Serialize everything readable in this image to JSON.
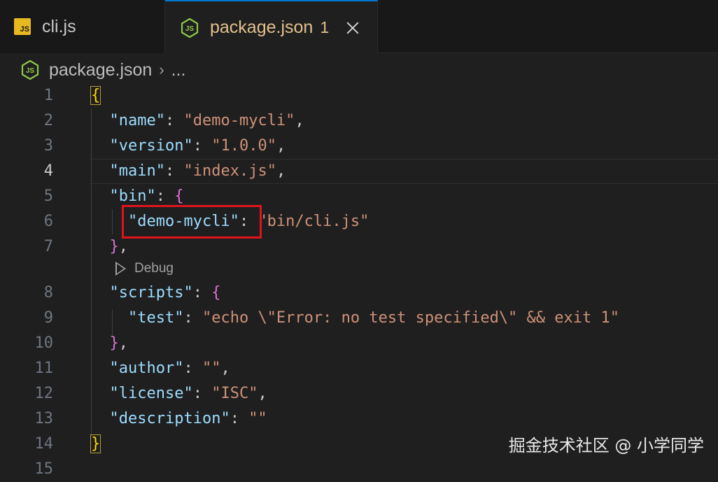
{
  "tabs": [
    {
      "label": "cli.js",
      "icon": "js-file-icon",
      "icon_text": "JS"
    },
    {
      "label": "package.json",
      "badge": "1",
      "icon": "node-json-icon"
    }
  ],
  "breadcrumb": {
    "file": "package.json",
    "separator": "›",
    "more": "..."
  },
  "codelens": {
    "label": "Debug"
  },
  "lines": [
    {
      "n": "1"
    },
    {
      "n": "2",
      "key": "\"name\"",
      "val": "\"demo-mycli\""
    },
    {
      "n": "3",
      "key": "\"version\"",
      "val": "\"1.0.0\""
    },
    {
      "n": "4",
      "key": "\"main\"",
      "val": "\"index.js\""
    },
    {
      "n": "5",
      "key": "\"bin\""
    },
    {
      "n": "6",
      "key": "\"demo-mycli\"",
      "val": "\"bin/cli.js\""
    },
    {
      "n": "7"
    },
    {
      "n": "8",
      "key": "\"scripts\""
    },
    {
      "n": "9",
      "key": "\"test\"",
      "val": "\"echo \\\"Error: no test specified\\\" && exit 1\""
    },
    {
      "n": "10"
    },
    {
      "n": "11",
      "key": "\"author\"",
      "val": "\"\""
    },
    {
      "n": "12",
      "key": "\"license\"",
      "val": "\"ISC\""
    },
    {
      "n": "13",
      "key": "\"description\"",
      "val": "\"\""
    },
    {
      "n": "14"
    },
    {
      "n": "15"
    }
  ],
  "watermark": "掘金技术社区 @ 小学同学",
  "colors": {
    "key": "#9cdcfe",
    "string": "#ce9178",
    "accent": "#0078d4",
    "highlight": "#e0141d"
  }
}
